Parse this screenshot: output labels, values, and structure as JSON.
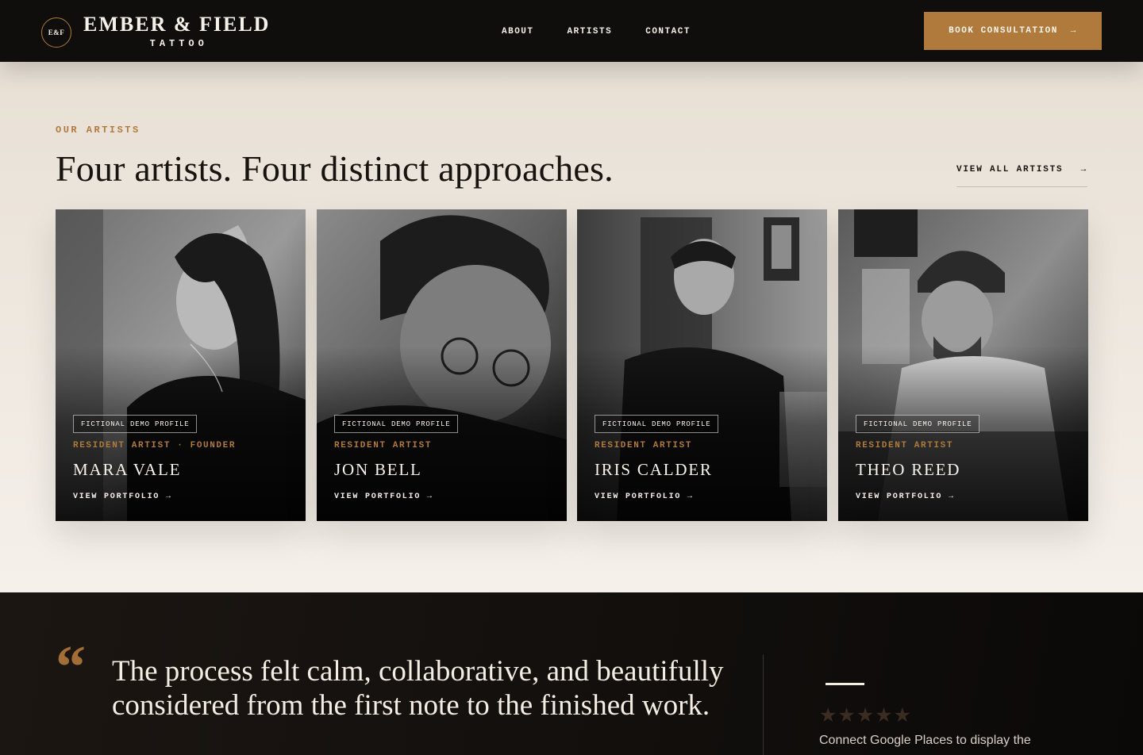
{
  "header": {
    "logo_badge": "E&F",
    "logo_name": "EMBER & FIELD",
    "logo_sub": "TATTOO",
    "nav": [
      "ABOUT",
      "ARTISTS",
      "CONTACT"
    ],
    "cta_label": "BOOK CONSULTATION",
    "cta_arrow": "→"
  },
  "artists_section": {
    "eyebrow": "OUR ARTISTS",
    "heading": "Four artists. Four distinct approaches.",
    "view_all_label": "VIEW ALL ARTISTS",
    "view_all_arrow": "→",
    "cards": [
      {
        "tag": "FICTIONAL DEMO PROFILE",
        "role": "RESIDENT ARTIST · FOUNDER",
        "name": "MARA VALE",
        "link": "VIEW PORTFOLIO →"
      },
      {
        "tag": "FICTIONAL DEMO PROFILE",
        "role": "RESIDENT ARTIST",
        "name": "JON BELL",
        "link": "VIEW PORTFOLIO →"
      },
      {
        "tag": "FICTIONAL DEMO PROFILE",
        "role": "RESIDENT ARTIST",
        "name": "IRIS CALDER",
        "link": "VIEW PORTFOLIO →"
      },
      {
        "tag": "FICTIONAL DEMO PROFILE",
        "role": "RESIDENT ARTIST",
        "name": "THEO REED",
        "link": "VIEW PORTFOLIO →"
      }
    ]
  },
  "testimonial": {
    "quote_mark": "“",
    "quote": "The process felt calm, collaborative, and beautifully considered from the first note to the finished work.",
    "stars": "★★★★★",
    "review_note": "Connect Google Places to display the"
  },
  "colors": {
    "accent": "#b07a3c",
    "header_bg": "#100e0c",
    "section_bg": "#f1ebe3",
    "dark_bg": "#120f0d"
  }
}
